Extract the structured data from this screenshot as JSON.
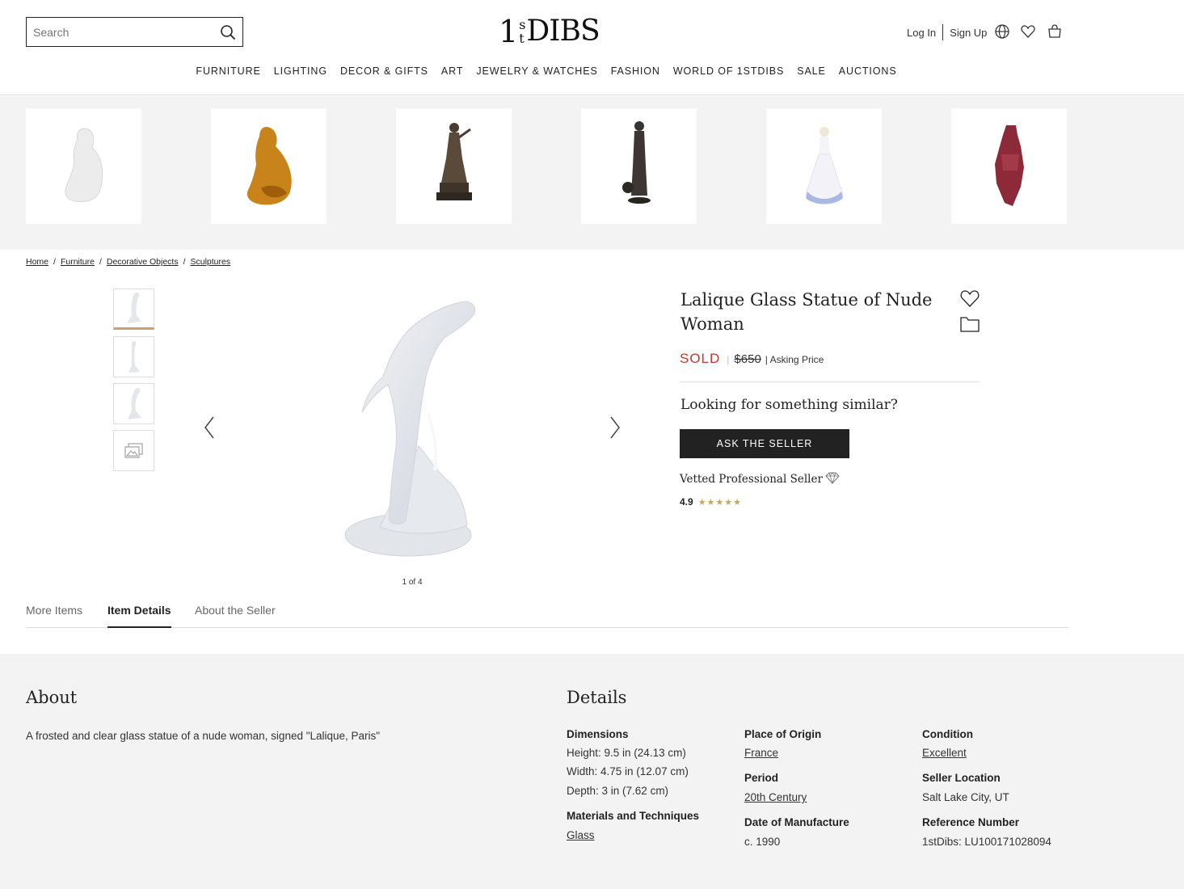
{
  "header": {
    "search_placeholder": "Search",
    "logo": {
      "one": "1",
      "s": "s",
      "t": "t",
      "dibs": "DIBS"
    },
    "login": "Log In",
    "signup": "Sign Up",
    "nav": [
      "FURNITURE",
      "LIGHTING",
      "DECOR & GIFTS",
      "ART",
      "JEWELRY & WATCHES",
      "FASHION",
      "WORLD OF 1STDIBS",
      "SALE",
      "AUCTIONS"
    ]
  },
  "recommendations": [
    {
      "kind": "white-figure",
      "color": "#e8e8e8"
    },
    {
      "kind": "amber-figure",
      "color": "#c8841a"
    },
    {
      "kind": "bronze-statue",
      "color": "#4a3e32"
    },
    {
      "kind": "bronze-woman",
      "color": "#3a3430"
    },
    {
      "kind": "porcelain-lady",
      "color": "#a8b8e0"
    },
    {
      "kind": "red-figure",
      "color": "#8c2a3a"
    }
  ],
  "breadcrumb": [
    "Home",
    "Furniture",
    "Decorative Objects",
    "Sculptures"
  ],
  "gallery": {
    "counter": "1 of 4"
  },
  "product": {
    "title": "Lalique Glass Statue of Nude Woman",
    "status": "SOLD",
    "price": "$650",
    "price_note": "| Asking Price",
    "similar_heading": "Looking for something similar?",
    "ask_button": "ASK THE SELLER",
    "seller_badge": "Vetted Professional Seller",
    "rating": "4.9",
    "stars": "★★★★★",
    "sold_color": "#c0392b",
    "accent_color": "#c2a661"
  },
  "tabs": [
    "More Items",
    "Item Details",
    "About the Seller"
  ],
  "active_tab": "Item Details",
  "about": {
    "heading": "About",
    "text": "A frosted and clear glass statue of a nude woman, signed \"Lalique, Paris\""
  },
  "details": {
    "heading": "Details",
    "dimensions_label": "Dimensions",
    "height": "Height: 9.5 in (24.13 cm)",
    "width": "Width: 4.75 in (12.07 cm)",
    "depth": "Depth: 3 in (7.62 cm)",
    "materials_label": "Materials and Techniques",
    "materials": "Glass",
    "origin_label": "Place of Origin",
    "origin": "France",
    "period_label": "Period",
    "period": "20th Century",
    "manufacture_label": "Date of Manufacture",
    "manufacture": "c. 1990",
    "condition_label": "Condition",
    "condition": "Excellent",
    "location_label": "Seller Location",
    "location": "Salt Lake City, UT",
    "reference_label": "Reference Number",
    "reference": "1stDibs: LU100171028094"
  }
}
